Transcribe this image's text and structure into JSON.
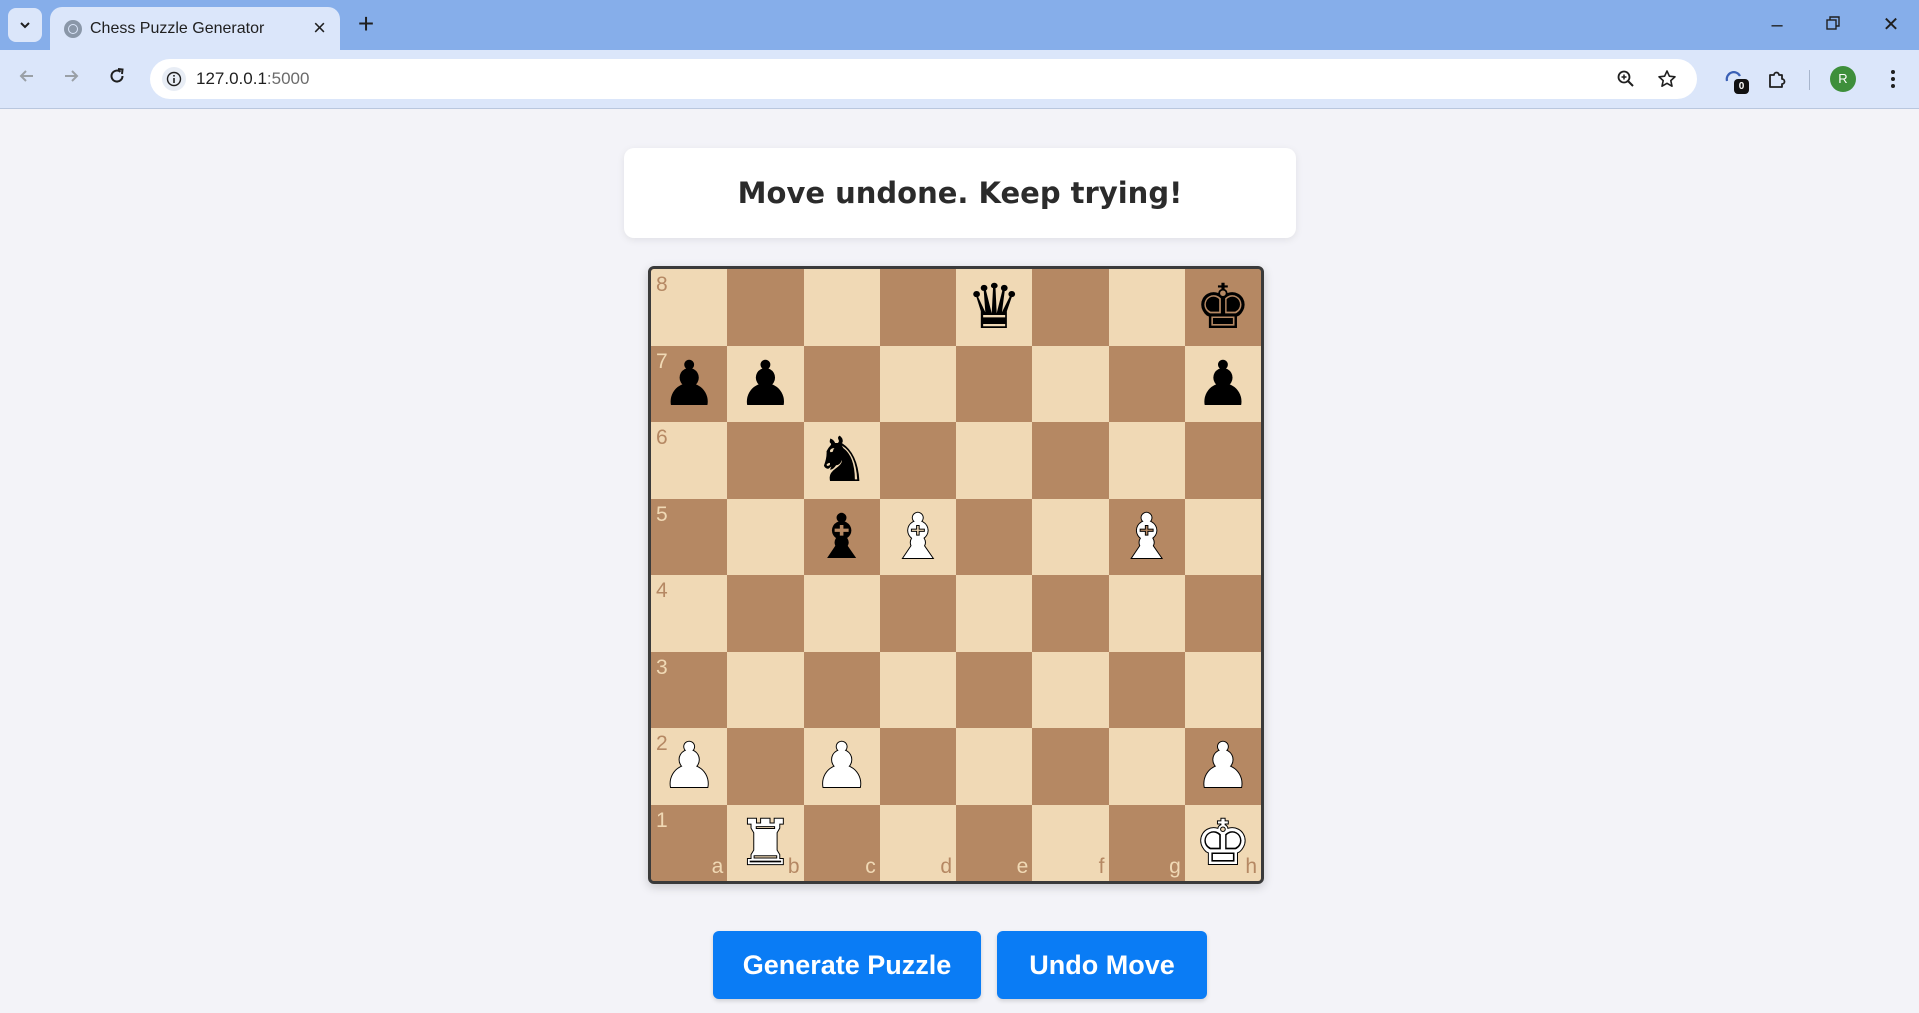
{
  "browser": {
    "tab_title": "Chess Puzzle Generator",
    "url_host": "127.0.0.1",
    "url_port": ":5000",
    "extension_badge": "0",
    "profile_initial": "R"
  },
  "status": {
    "message": "Move undone. Keep trying!"
  },
  "board": {
    "light_color": "#f0d9b5",
    "dark_color": "#b58863",
    "ranks": [
      "8",
      "7",
      "6",
      "5",
      "4",
      "3",
      "2",
      "1"
    ],
    "files": [
      "a",
      "b",
      "c",
      "d",
      "e",
      "f",
      "g",
      "h"
    ],
    "pieces": {
      "e8": {
        "glyph": "♛",
        "color": "black",
        "name": "black-queen"
      },
      "h8": {
        "glyph": "♚",
        "color": "black",
        "name": "black-king"
      },
      "a7": {
        "glyph": "♟",
        "color": "black",
        "name": "black-pawn"
      },
      "b7": {
        "glyph": "♟",
        "color": "black",
        "name": "black-pawn"
      },
      "h7": {
        "glyph": "♟",
        "color": "black",
        "name": "black-pawn"
      },
      "c6": {
        "glyph": "♞",
        "color": "black",
        "name": "black-knight"
      },
      "c5": {
        "glyph": "♝",
        "color": "black",
        "name": "black-bishop"
      },
      "d5": {
        "glyph": "♝",
        "color": "white",
        "name": "white-bishop"
      },
      "g5": {
        "glyph": "♝",
        "color": "white",
        "name": "white-bishop"
      },
      "a2": {
        "glyph": "♟",
        "color": "white",
        "name": "white-pawn"
      },
      "c2": {
        "glyph": "♟",
        "color": "white",
        "name": "white-pawn"
      },
      "h2": {
        "glyph": "♟",
        "color": "white",
        "name": "white-pawn"
      },
      "b1": {
        "glyph": "♜",
        "color": "white",
        "name": "white-rook"
      },
      "h1": {
        "glyph": "♚",
        "color": "white",
        "name": "white-king"
      }
    }
  },
  "buttons": {
    "generate_label": "Generate Puzzle",
    "undo_label": "Undo Move"
  }
}
